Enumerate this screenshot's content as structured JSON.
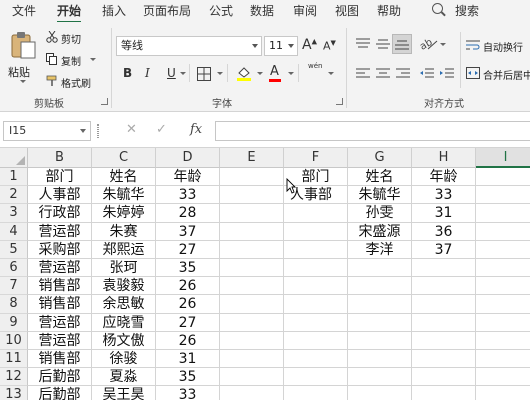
{
  "menu": {
    "tabs": [
      "文件",
      "开始",
      "插入",
      "页面布局",
      "公式",
      "数据",
      "审阅",
      "视图",
      "帮助"
    ],
    "search_label": "搜索"
  },
  "ribbon": {
    "paste_label": "粘贴",
    "cut_label": "剪切",
    "copy_label": "复制",
    "format_painter_label": "格式刷",
    "clipboard_group": "剪贴板",
    "font_name": "等线",
    "font_size": "11",
    "grow_font": "A",
    "shrink_font": "A",
    "bold": "B",
    "italic": "I",
    "underline": "U",
    "font_color_glyph": "A",
    "phonetic_glyph": "wén",
    "font_group": "字体",
    "wrap_text_label": "自动换行",
    "merge_center_label": "合并后居中",
    "alignment_group": "对齐方式"
  },
  "formula_bar": {
    "name_box": "I15",
    "fx": "fx",
    "formula": ""
  },
  "sheet": {
    "columns": [
      "B",
      "C",
      "D",
      "E",
      "F",
      "G",
      "H",
      "I"
    ],
    "selected_column": "I",
    "rows": [
      {
        "n": "1",
        "B": "部门",
        "C": "姓名",
        "D": "年龄",
        "F": "部门",
        "G": "姓名",
        "H": "年龄"
      },
      {
        "n": "2",
        "B": "人事部",
        "C": "朱毓华",
        "D": "33",
        "F": "人事部",
        "G": "朱毓华",
        "H": "33"
      },
      {
        "n": "3",
        "B": "行政部",
        "C": "朱婷婷",
        "D": "28",
        "F": "",
        "G": "孙雯",
        "H": "31"
      },
      {
        "n": "4",
        "B": "营运部",
        "C": "朱赛",
        "D": "37",
        "F": "",
        "G": "宋盛源",
        "H": "36"
      },
      {
        "n": "5",
        "B": "采购部",
        "C": "郑熙运",
        "D": "27",
        "F": "",
        "G": "李洋",
        "H": "37"
      },
      {
        "n": "6",
        "B": "营运部",
        "C": "张珂",
        "D": "35"
      },
      {
        "n": "7",
        "B": "销售部",
        "C": "袁骏毅",
        "D": "26"
      },
      {
        "n": "8",
        "B": "销售部",
        "C": "余思敏",
        "D": "26"
      },
      {
        "n": "9",
        "B": "营运部",
        "C": "应晓雪",
        "D": "27"
      },
      {
        "n": "10",
        "B": "营运部",
        "C": "杨文傲",
        "D": "26"
      },
      {
        "n": "11",
        "B": "销售部",
        "C": "徐骏",
        "D": "31"
      },
      {
        "n": "12",
        "B": "后勤部",
        "C": "夏淼",
        "D": "35"
      },
      {
        "n": "13",
        "B": "后勤部",
        "C": "吴王昊",
        "D": "33"
      }
    ]
  },
  "colors": {
    "accent": "#217346",
    "highlight_fill": "#ffff00",
    "font_color": "#ff0000"
  }
}
